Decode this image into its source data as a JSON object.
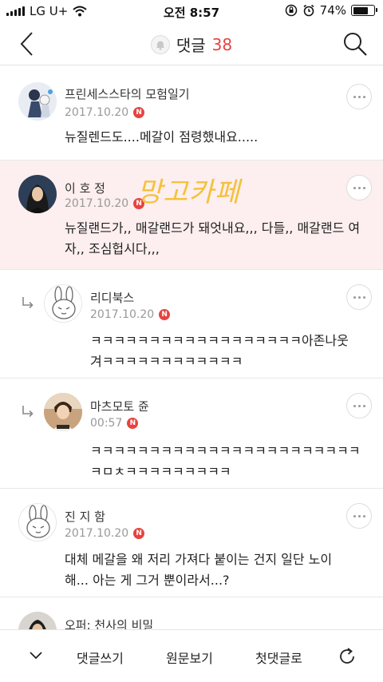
{
  "status_bar": {
    "carrier": "LG U+",
    "time": "오전 8:57",
    "battery_percent": "74%",
    "battery_level": 0.74
  },
  "header": {
    "title": "댓글",
    "count": "38",
    "accent_color": "#e8433f"
  },
  "comments": [
    {
      "author": "프린세스스타의 모험일기",
      "date": "2017.10.20",
      "badge": "N",
      "text": "뉴질렌드도....메갈이 점령했내요.....",
      "highlight": false,
      "reply": false
    },
    {
      "author": "이 호 정",
      "date": "2017.10.20",
      "badge": "N",
      "text": "뉴질랜드가,, 매갈랜드가 돼엇내요,,, 다들,, 매갈랜드 여자,, 조심헙시다,,,",
      "highlight": true,
      "reply": false,
      "overlay": "망고카페"
    },
    {
      "author": "리디북스",
      "date": "2017.10.20",
      "badge": "N",
      "text": "ㅋㅋㅋㅋㅋㅋㅋㅋㅋㅋㅋㅋㅋㅋㅋㅋㅋㅋ아존나웃겨ㅋㅋㅋㅋㅋㅋㅋㅋㅋㅋㅋㅋ",
      "highlight": false,
      "reply": true
    },
    {
      "author": "마츠모토 쥰",
      "date": "00:57",
      "badge": "N",
      "text": "ㅋㅋㅋㅋㅋㅋㅋㅋㅋㅋㅋㅋㅋㅋㅋㅋㅋㅋㅋㅋㅋㅋㅋㅋㅁㅊㅋㅋㅋㅋㅋㅋㅋㅋㅋ",
      "highlight": false,
      "reply": true
    },
    {
      "author": "진 지 함",
      "date": "2017.10.20",
      "badge": "N",
      "text": "대체 메갈을 왜 저리 가져다 붙이는 건지 일단 노이해... 아는 게 그거 뿐이라서...?",
      "highlight": false,
      "reply": false
    },
    {
      "author": "오퍼: 천사의 비밀",
      "date": "",
      "badge": "",
      "text": "",
      "highlight": false,
      "reply": false
    }
  ],
  "bottom_bar": {
    "write_comment": "댓글쓰기",
    "view_original": "원문보기",
    "first_comment": "첫댓글로"
  }
}
